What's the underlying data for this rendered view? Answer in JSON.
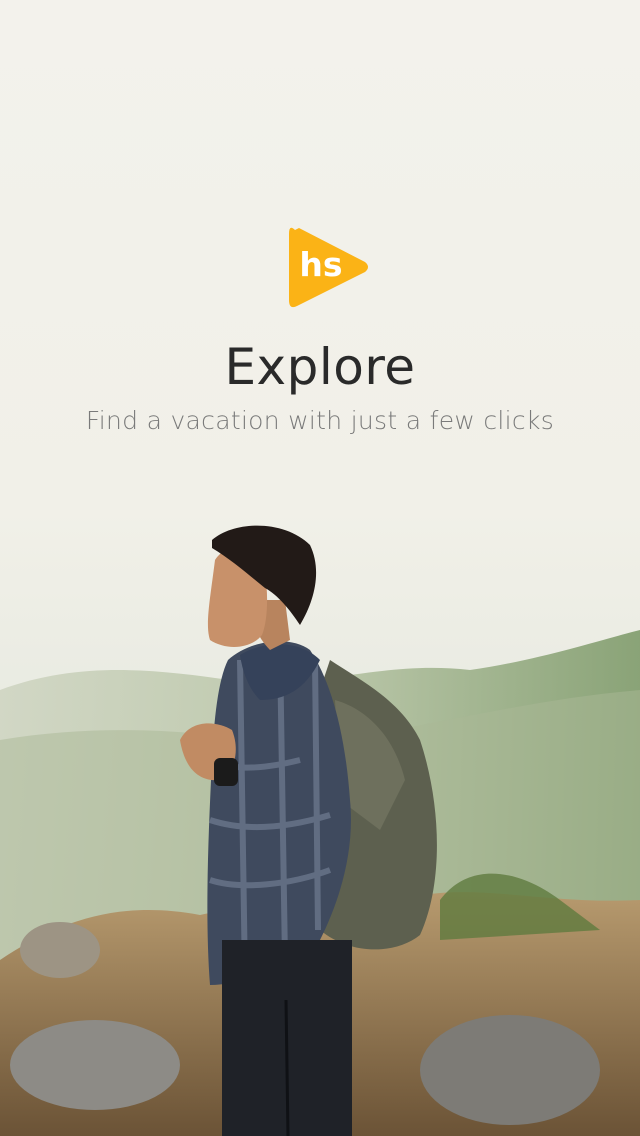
{
  "logo": {
    "text": "hs",
    "color": "#FBB316"
  },
  "title": "Explore",
  "subtitle": "Find a vacation with just a few clicks",
  "background": {
    "icon": "hiker-backpack-mountain-photo"
  }
}
